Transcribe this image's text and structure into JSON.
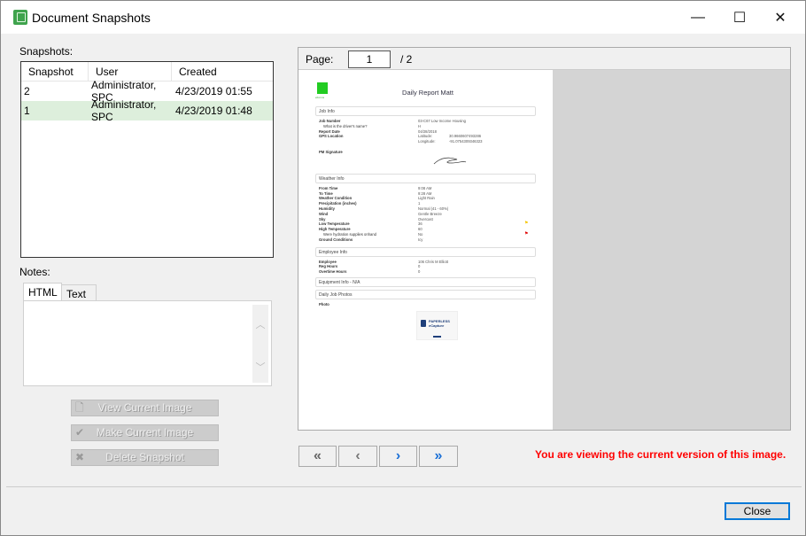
{
  "window": {
    "title": "Document Snapshots",
    "controls": {
      "minimize": "—",
      "maximize": "☐",
      "close": "✕"
    }
  },
  "snapshots": {
    "label": "Snapshots:",
    "columns": [
      "Snapshot",
      "User",
      "Created"
    ],
    "rows": [
      {
        "snapshot": "2",
        "user": "Administrator, SPC",
        "created": "4/23/2019 01:55"
      },
      {
        "snapshot": "1",
        "user": "Administrator, SPC",
        "created": "4/23/2019 01:48",
        "selected": true
      }
    ]
  },
  "notes": {
    "label": "Notes:",
    "tabs": [
      "HTML",
      "Text"
    ],
    "active_tab": "HTML"
  },
  "actions": {
    "view": "View Current Image",
    "make": "Make Current Image",
    "delete": "Delete Snapshot"
  },
  "viewer": {
    "page_label": "Page:",
    "page": "1",
    "total": "/ 2",
    "document": {
      "logo_text": "eForms",
      "title": "Daily Report Matt",
      "sections": [
        {
          "title": "Job Info",
          "rows": [
            {
              "k": "Job Number",
              "v": "03-C67 Low Income Housing"
            },
            {
              "k": "What is the driver's name?",
              "v": "H",
              "sub": true
            },
            {
              "k": "Report Date",
              "v": "04/28/2018"
            },
            {
              "k": "GPS Location",
              "v": "Latitude:",
              "v2": "30.9660607493286"
            },
            {
              "k": "",
              "v": "Longitude:",
              "v2": "-91.0754309346323"
            },
            {
              "k": "PM Signature",
              "v": ""
            }
          ]
        },
        {
          "title": "Weather Info",
          "rows": [
            {
              "k": "From Time",
              "v": "9:08 AM"
            },
            {
              "k": "To Time",
              "v": "9:28 AM"
            },
            {
              "k": "Weather Condition",
              "v": "Light Rain"
            },
            {
              "k": "Precipitation (inches)",
              "v": "1"
            },
            {
              "k": "Humidity",
              "v": "Normal (41 - 60%)"
            },
            {
              "k": "Wind",
              "v": "Gentle Breeze"
            },
            {
              "k": "Sky",
              "v": "Overcast"
            },
            {
              "k": "Low Temperature",
              "v": "36",
              "flag": "#f5c400"
            },
            {
              "k": "High Temperature",
              "v": "60"
            },
            {
              "k": "Were hydration supplies onhand",
              "v": "No",
              "sub": true,
              "flag": "#e00000"
            },
            {
              "k": "Ground Conditions",
              "v": "Icy"
            }
          ]
        },
        {
          "title": "Employee Info",
          "rows": [
            {
              "k": "Employee",
              "v": "106  Chris M Elliott"
            },
            {
              "k": "Reg Hours",
              "v": "0"
            },
            {
              "k": "Overtime Hours",
              "v": "0"
            }
          ]
        },
        {
          "title": "Equipment Info - N/A",
          "rows": []
        },
        {
          "title": "Daily Job Photos",
          "rows": [
            {
              "k": "Photo",
              "v": ""
            }
          ]
        }
      ],
      "photo_text": [
        "PAPERLESS",
        "eCapture"
      ]
    }
  },
  "message": "You are viewing the current version of this image.",
  "message_color": "#ff0000",
  "close_label": "Close"
}
